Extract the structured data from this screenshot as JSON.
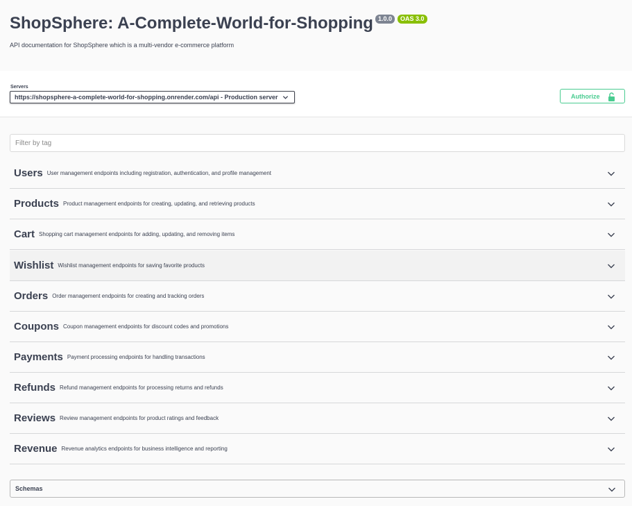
{
  "info": {
    "title": "ShopSphere: A-Complete-World-for-Shopping",
    "version_badge": "1.0.0",
    "oas_badge": "OAS 3.0",
    "description": "API documentation for ShopSphere which is a multi-vendor e-commerce platform"
  },
  "servers": {
    "label": "Servers",
    "selected": "https://shopsphere-a-complete-world-for-shopping.onrender.com/api - Production server"
  },
  "authorize": {
    "label": "Authorize"
  },
  "filter": {
    "placeholder": "Filter by tag"
  },
  "tags": [
    {
      "name": "Users",
      "description": "User management endpoints including registration, authentication, and profile management"
    },
    {
      "name": "Products",
      "description": "Product management endpoints for creating, updating, and retrieving products"
    },
    {
      "name": "Cart",
      "description": "Shopping cart management endpoints for adding, updating, and removing items"
    },
    {
      "name": "Wishlist",
      "description": "Wishlist management endpoints for saving favorite products"
    },
    {
      "name": "Orders",
      "description": "Order management endpoints for creating and tracking orders"
    },
    {
      "name": "Coupons",
      "description": "Coupon management endpoints for discount codes and promotions"
    },
    {
      "name": "Payments",
      "description": "Payment processing endpoints for handling transactions"
    },
    {
      "name": "Refunds",
      "description": "Refund management endpoints for processing returns and refunds"
    },
    {
      "name": "Reviews",
      "description": "Review management endpoints for product ratings and feedback"
    },
    {
      "name": "Revenue",
      "description": "Revenue analytics endpoints for business intelligence and reporting"
    }
  ],
  "schemas": {
    "label": "Schemas"
  },
  "colors": {
    "accent_green": "#49cc90",
    "version_badge_bg": "#7d8492",
    "oas_badge_bg": "#89bf04",
    "text": "#3b4151"
  }
}
